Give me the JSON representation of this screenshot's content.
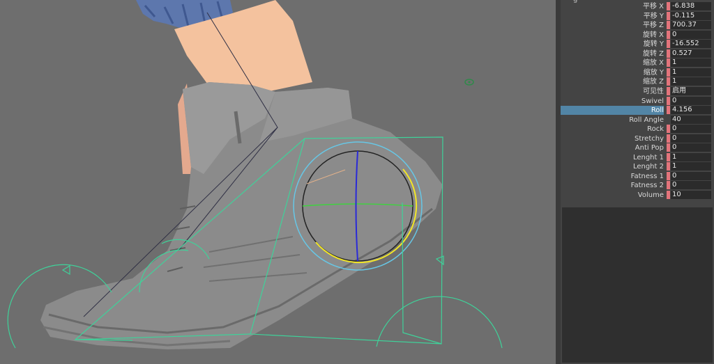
{
  "channel_box": {
    "top_label": "g",
    "rows": [
      {
        "name": "平移 X",
        "value": "-6.838"
      },
      {
        "name": "平移 Y",
        "value": "-0.115"
      },
      {
        "name": "平移 Z",
        "value": "700.37"
      },
      {
        "name": "旋转 X",
        "value": "0"
      },
      {
        "name": "旋转 Y",
        "value": "-16.552"
      },
      {
        "name": "旋转 Z",
        "value": "0.527"
      },
      {
        "name": "缩放 X",
        "value": "1"
      },
      {
        "name": "缩放 Y",
        "value": "1"
      },
      {
        "name": "缩放 Z",
        "value": "1"
      },
      {
        "name": "可见性",
        "value": "启用"
      },
      {
        "name": "Swivel",
        "value": "0"
      },
      {
        "name": "Roll",
        "value": "4.156",
        "selected": true
      },
      {
        "name": "Roll Angle",
        "value": "40",
        "nokey": true
      },
      {
        "name": "Rock",
        "value": "0"
      },
      {
        "name": "Stretchy",
        "value": "0"
      },
      {
        "name": "Anti Pop",
        "value": "0"
      },
      {
        "name": "Lenght 1",
        "value": "1"
      },
      {
        "name": "Lenght 2",
        "value": "1"
      },
      {
        "name": "Fatness 1",
        "value": "0"
      },
      {
        "name": "Fatness 2",
        "value": "0"
      },
      {
        "name": "Volume",
        "value": "10"
      }
    ]
  },
  "colors": {
    "viewport_bg": "#6e6e6e",
    "controller_green": "#3fd29a",
    "key_red": "#e3747b",
    "selection_blue": "#5285a6"
  }
}
